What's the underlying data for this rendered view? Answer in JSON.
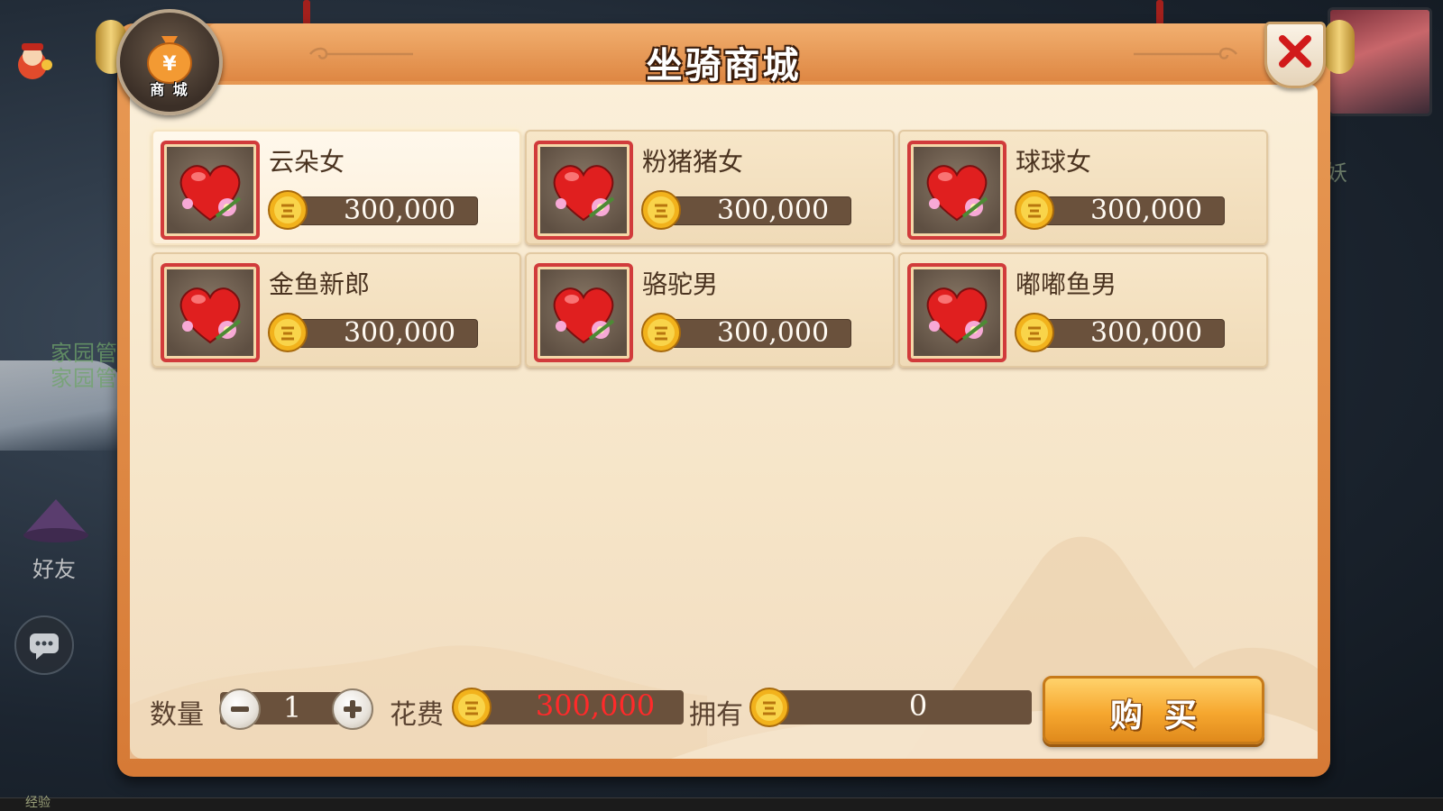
{
  "background": {
    "left_labels": [
      "家园管",
      "家园管"
    ],
    "friend_label": "好友",
    "bottom_left_label": "经验",
    "right_edge_label": "妖"
  },
  "dialog": {
    "title": "坐骑商城",
    "badge_label": "商 城",
    "badge_symbol": "¥"
  },
  "items": [
    {
      "name": "云朵女",
      "price": "300,000",
      "selected": true
    },
    {
      "name": "粉猪猪女",
      "price": "300,000",
      "selected": false
    },
    {
      "name": "球球女",
      "price": "300,000",
      "selected": false
    },
    {
      "name": "金鱼新郎",
      "price": "300,000",
      "selected": false
    },
    {
      "name": "骆驼男",
      "price": "300,000",
      "selected": false
    },
    {
      "name": "嘟嘟鱼男",
      "price": "300,000",
      "selected": false
    }
  ],
  "footer": {
    "quantity_label": "数量",
    "quantity_value": "1",
    "cost_label": "花费",
    "cost_value": "300,000",
    "owned_label": "拥有",
    "owned_value": "0",
    "buy_label": "购买"
  },
  "colors": {
    "cost_text": "#ff2a2a",
    "item_frame": "#d13b3b",
    "dialog_border": "#de8743",
    "buy_button": "#f6a72f"
  },
  "icons": [
    "mount-heart-icon",
    "gold-coin-icon",
    "close-icon",
    "minus-icon",
    "plus-icon",
    "money-bag-icon",
    "chat-icon"
  ]
}
